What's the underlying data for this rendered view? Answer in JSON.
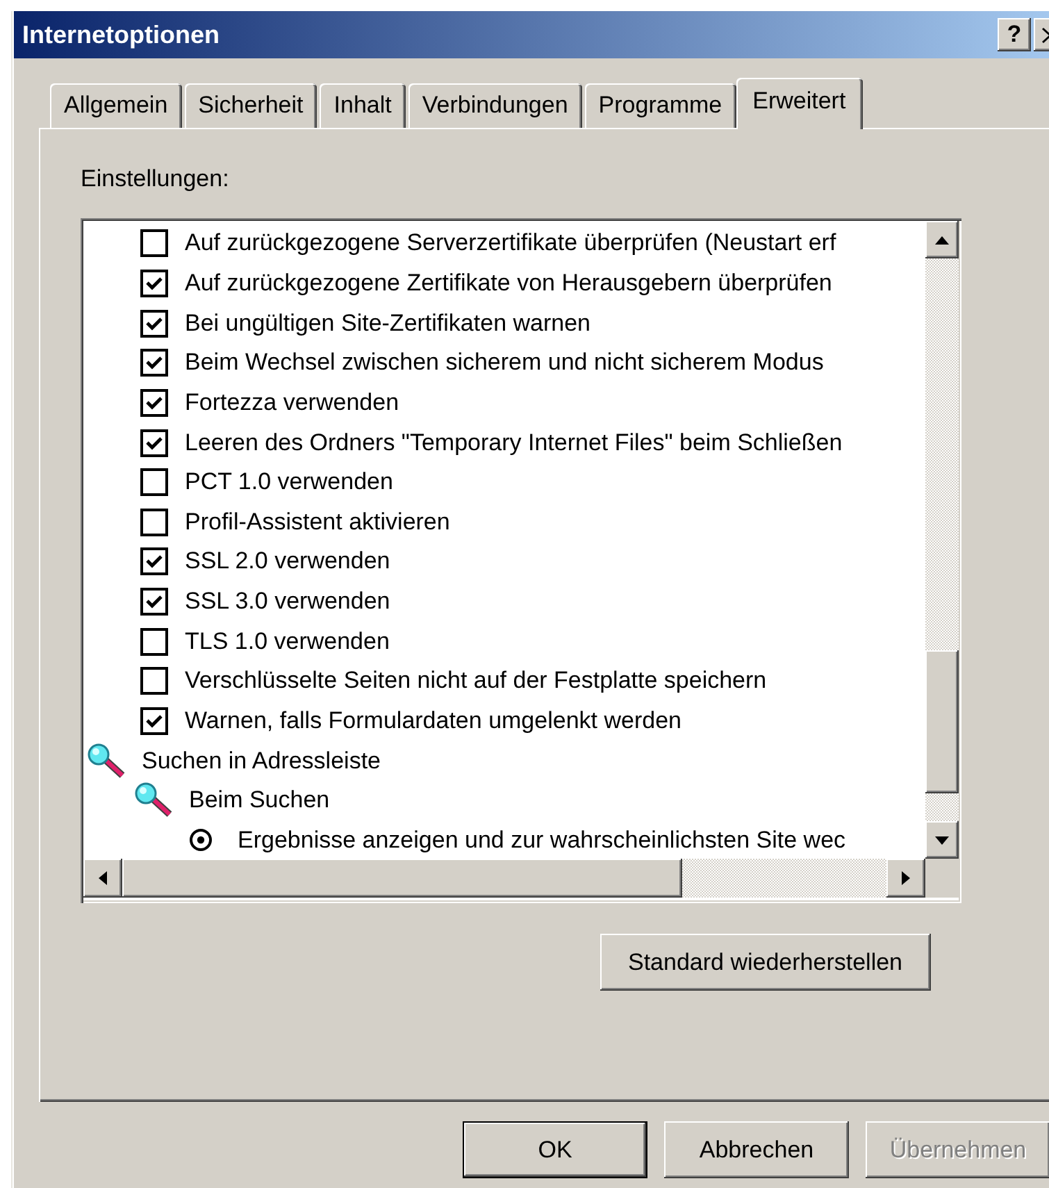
{
  "window": {
    "title": "Internetoptionen",
    "help_button": "?"
  },
  "tabs": [
    {
      "label": "Allgemein",
      "selected": false
    },
    {
      "label": "Sicherheit",
      "selected": false
    },
    {
      "label": "Inhalt",
      "selected": false
    },
    {
      "label": "Verbindungen",
      "selected": false
    },
    {
      "label": "Programme",
      "selected": false
    },
    {
      "label": "Erweitert",
      "selected": true
    }
  ],
  "settings_label": "Einstellungen:",
  "settings": [
    {
      "kind": "checkbox",
      "label": "Auf zurückgezogene Serverzertifikate überprüfen (Neustart erf",
      "checked": false
    },
    {
      "kind": "checkbox",
      "label": "Auf zurückgezogene Zertifikate von Herausgebern überprüfen",
      "checked": true
    },
    {
      "kind": "checkbox",
      "label": "Bei ungültigen Site-Zertifikaten warnen",
      "checked": true
    },
    {
      "kind": "checkbox",
      "label": "Beim Wechsel zwischen sicherem und nicht sicherem Modus",
      "checked": true
    },
    {
      "kind": "checkbox",
      "label": "Fortezza verwenden",
      "checked": true
    },
    {
      "kind": "checkbox",
      "label": "Leeren des Ordners \"Temporary Internet Files\" beim Schließen",
      "checked": true
    },
    {
      "kind": "checkbox",
      "label": "PCT 1.0 verwenden",
      "checked": false
    },
    {
      "kind": "checkbox",
      "label": "Profil-Assistent aktivieren",
      "checked": false
    },
    {
      "kind": "checkbox",
      "label": "SSL 2.0 verwenden",
      "checked": true
    },
    {
      "kind": "checkbox",
      "label": "SSL 3.0 verwenden",
      "checked": true
    },
    {
      "kind": "checkbox",
      "label": "TLS 1.0 verwenden",
      "checked": false
    },
    {
      "kind": "checkbox",
      "label": "Verschlüsselte Seiten nicht auf der Festplatte speichern",
      "checked": false
    },
    {
      "kind": "checkbox",
      "label": "Warnen, falls Formulardaten umgelenkt werden",
      "checked": true
    },
    {
      "kind": "group",
      "label": "Suchen in Adressleiste",
      "children": [
        {
          "kind": "group",
          "label": "Beim Suchen",
          "children": [
            {
              "kind": "radio",
              "label": "Ergebnisse anzeigen und zur wahrscheinlichsten Site wec",
              "selected": true
            }
          ]
        }
      ]
    }
  ],
  "restore_button": "Standard wiederherstellen",
  "buttons": [
    {
      "label": "OK",
      "default": true,
      "disabled": false
    },
    {
      "label": "Abbrechen",
      "default": false,
      "disabled": false
    },
    {
      "label": "Übernehmen",
      "default": false,
      "disabled": true
    }
  ]
}
